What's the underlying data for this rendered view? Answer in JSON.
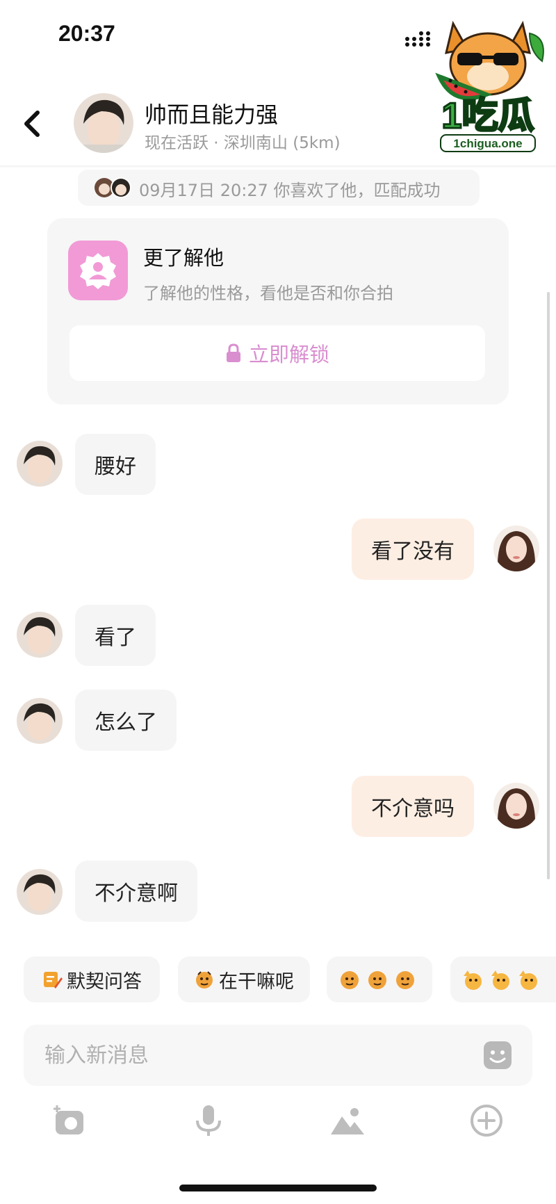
{
  "status_bar": {
    "time": "20:37"
  },
  "watermark": {
    "brand": "1吃瓜",
    "domain": "1chigua.one"
  },
  "header": {
    "name": "帅而且能力强",
    "status": "现在活跃 · 深圳南山 (5km)"
  },
  "match_notice": {
    "text": "09月17日 20:27 你喜欢了他，匹配成功"
  },
  "unlock_card": {
    "title": "更了解他",
    "subtitle": "了解他的性格，看他是否和你合拍",
    "button_label": "立即解锁"
  },
  "messages": [
    {
      "side": "in",
      "text": "腰好"
    },
    {
      "side": "out",
      "text": "看了没有"
    },
    {
      "side": "in",
      "text": "看了"
    },
    {
      "side": "in",
      "text": "怎么了"
    },
    {
      "side": "out",
      "text": "不介意吗"
    },
    {
      "side": "in",
      "text": "不介意啊"
    }
  ],
  "quick_replies": [
    {
      "label": "默契问答",
      "icon": "note-pencil-icon"
    },
    {
      "label": "在干嘛呢",
      "icon": "tiger-emoji-icon"
    },
    {
      "label": "",
      "icon": "tiger-emoji-triple-icon"
    },
    {
      "label": "",
      "icon": "tiger-wave-triple-icon"
    }
  ],
  "composer": {
    "placeholder": "输入新消息"
  },
  "toolbar": [
    "camera-icon",
    "microphone-icon",
    "image-icon",
    "plus-circle-icon"
  ],
  "colors": {
    "accent_pink": "#f19ad6",
    "unlock_text": "#d98ed0",
    "incoming_bubble": "#f5f5f5",
    "outgoing_bubble": "#fdeee3"
  }
}
